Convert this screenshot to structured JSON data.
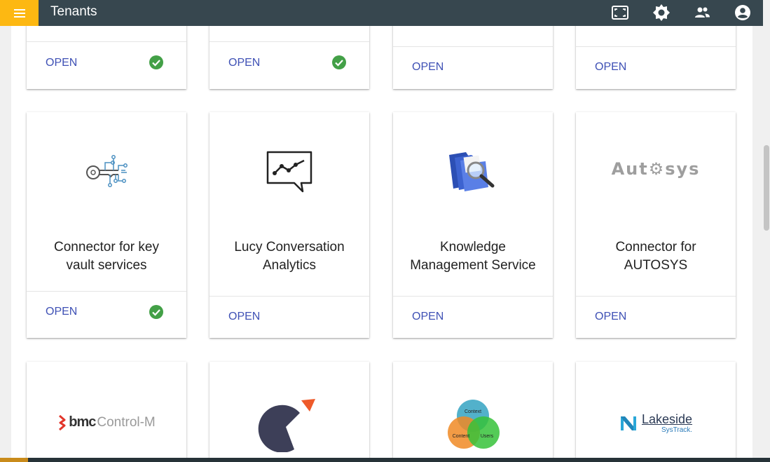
{
  "topbar": {
    "title": "Tenants",
    "icons": [
      "menu-icon",
      "fullscreen-icon",
      "settings-gear-icon",
      "people-icon",
      "account-circle-icon"
    ]
  },
  "colors": {
    "topbar": "#37474f",
    "menu_button": "#fdb812",
    "link": "#3f51b5",
    "check": "#43a047"
  },
  "cards_row1": [
    {
      "action": "OPEN",
      "status": "check"
    },
    {
      "action": "OPEN",
      "status": "check"
    },
    {
      "action": "OPEN",
      "status": ""
    },
    {
      "action": "OPEN",
      "status": ""
    }
  ],
  "cards_row2": [
    {
      "name_line1": "Connector for key",
      "name_line2": "vault services",
      "action": "OPEN",
      "status": "check",
      "icon": "key-circuit-icon"
    },
    {
      "name_line1": "Lucy Conversation",
      "name_line2": "Analytics",
      "action": "OPEN",
      "status": "",
      "icon": "chart-chat-icon"
    },
    {
      "name_line1": "Knowledge",
      "name_line2": "Management Service",
      "action": "OPEN",
      "status": "",
      "icon": "folders-magnifier-icon"
    },
    {
      "name_line1": "Connector for",
      "name_line2": "AUTOSYS",
      "action": "OPEN",
      "status": "",
      "icon": "autosys-logo"
    }
  ],
  "cards_row3": [
    {
      "icon": "bmc-control-m-logo",
      "logo_text_a": "bmc",
      "logo_text_b": "Control-M"
    },
    {
      "icon": "pie-arrow-logo"
    },
    {
      "icon": "venn-diagram-logo",
      "venn": [
        "Context",
        "Content",
        "Users"
      ]
    },
    {
      "icon": "lakeside-systrack-logo",
      "logo_text_a": "Lakeside",
      "logo_text_b": "SysTrack."
    }
  ],
  "autosys_logo_text": "Aut⚙sys"
}
